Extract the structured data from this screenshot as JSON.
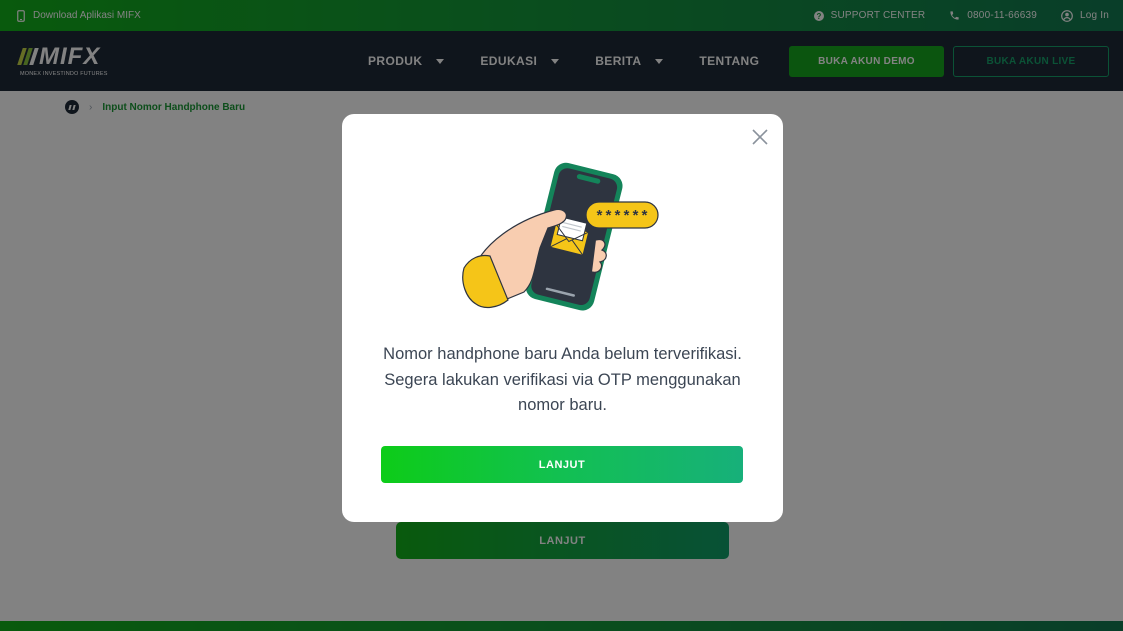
{
  "topbar": {
    "download_label": "Download Aplikasi MIFX",
    "support_label": "SUPPORT CENTER",
    "phone_label": "0800-11-66639",
    "login_label": "Log In"
  },
  "logo": {
    "word": "MIFX",
    "subtitle": "MONEX INVESTINDO FUTURES"
  },
  "nav": {
    "items": [
      {
        "label": "PRODUK",
        "has_caret": true
      },
      {
        "label": "EDUKASI",
        "has_caret": true
      },
      {
        "label": "BERITA",
        "has_caret": true
      },
      {
        "label": "TENTANG",
        "has_caret": false
      }
    ],
    "demo_button": "BUKA AKUN DEMO",
    "live_button": "BUKA AKUN LIVE"
  },
  "breadcrumb": {
    "current": "Input Nomor Handphone Baru"
  },
  "page": {
    "background_button": "LANJUT"
  },
  "modal": {
    "otp_text": "******",
    "message": "Nomor handphone baru Anda belum terverifikasi. Segera lakukan verifikasi via OTP menggunakan nomor baru.",
    "button_label": "LANJUT"
  },
  "colors": {
    "brand_green": "#16a81e",
    "navbar": "#1f2a38",
    "accent_yellow": "#f5c518"
  }
}
